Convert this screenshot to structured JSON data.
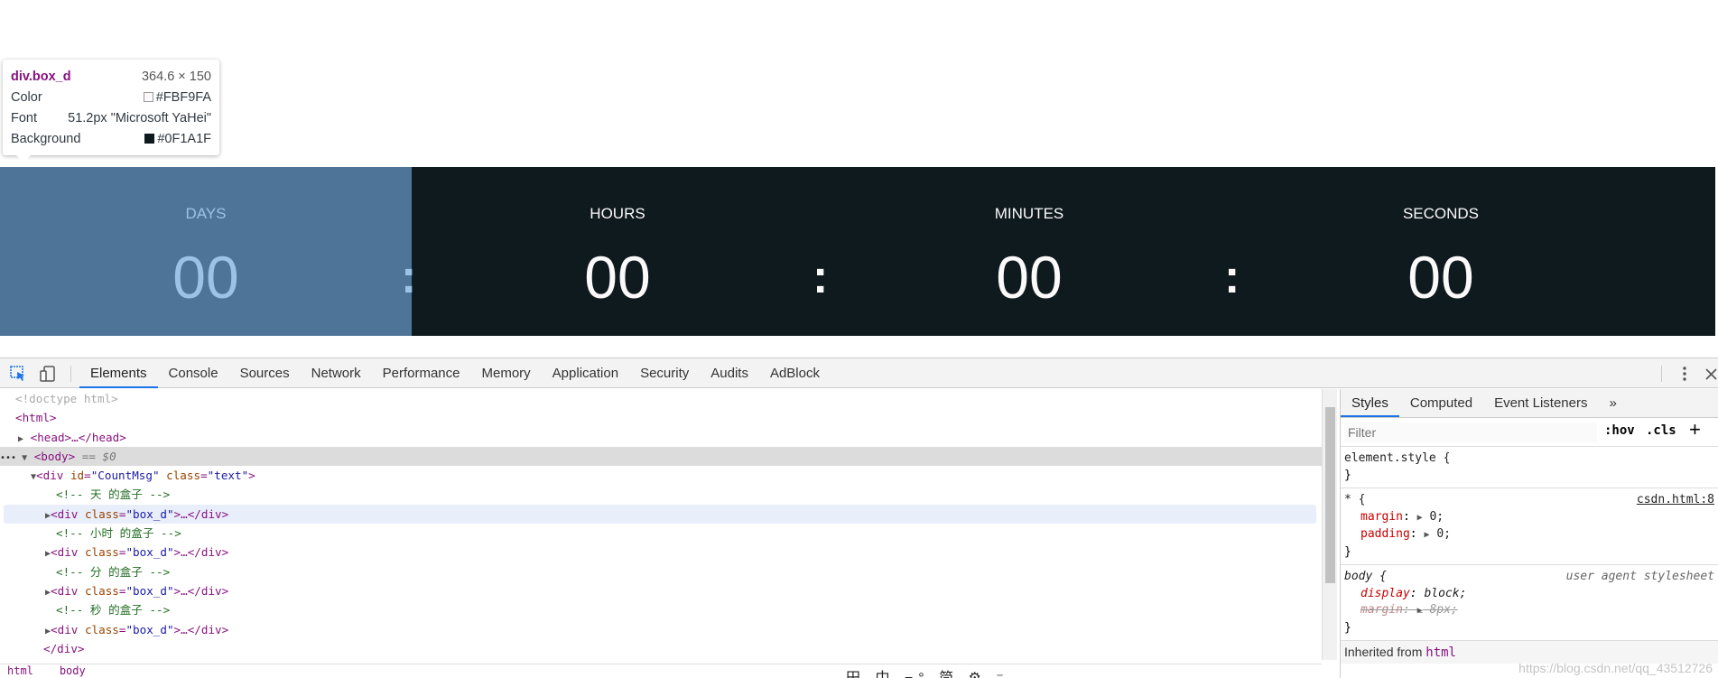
{
  "countdown": {
    "boxes": [
      {
        "label": "DAYS",
        "value": "00",
        "colon": ":"
      },
      {
        "label": "HOURS",
        "value": "00",
        "colon": ":"
      },
      {
        "label": "MINUTES",
        "value": "00",
        "colon": ":"
      },
      {
        "label": "SECONDS",
        "value": "00",
        "colon": ""
      }
    ],
    "bg_color": "#0F1A1F",
    "highlight_color": "#4e7598"
  },
  "tooltip": {
    "tag": "div.box_d",
    "dims": "364.6 × 150",
    "color_label": "Color",
    "color_value": "#FBF9FA",
    "font_label": "Font",
    "font_value": "51.2px \"Microsoft YaHei\"",
    "bg_label": "Background",
    "bg_value": "#0F1A1F"
  },
  "devtools": {
    "tabs": [
      "Elements",
      "Console",
      "Sources",
      "Network",
      "Performance",
      "Memory",
      "Application",
      "Security",
      "Audits",
      "AdBlock"
    ],
    "active_tab": "Elements",
    "dom": {
      "doctype": "<!doctype html>",
      "html_open": "<html>",
      "head": "<head>…</head>",
      "body": "<body>",
      "body_eq": " == $0",
      "div_open_tag": "<div ",
      "div_id_attr": "id",
      "div_id_val": "\"CountMsg\"",
      "div_class_attr": "class",
      "div_class_val": "\"text\"",
      "div_close_bracket": ">",
      "comment_day": "<!-- 天 的盒子 -->",
      "comment_hour": "<!-- 小时 的盒子 -->",
      "comment_min": "<!-- 分 的盒子 -->",
      "comment_sec": "<!-- 秒 的盒子 -->",
      "box_open": "<div ",
      "box_class_attr": "class",
      "box_class_val": "\"box_d\"",
      "box_rest": ">…</div>",
      "div_close": "</div>"
    },
    "breadcrumbs": [
      "html",
      "body"
    ],
    "ime_bar": "田 中 ⌐° 简 ⚙ ⁻",
    "styles": {
      "tabs": [
        "Styles",
        "Computed",
        "Event Listeners"
      ],
      "more": "»",
      "filter_placeholder": "Filter",
      "hov": ":hov",
      "cls": ".cls",
      "plus": "+",
      "element_style": "element.style {",
      "close_brace": "}",
      "universal_selector": "* {",
      "universal_source": "csdn.html:8",
      "margin_prop": "margin",
      "margin_val": "0;",
      "padding_prop": "padding",
      "padding_val": "0;",
      "body_selector": "body {",
      "ua_label": "user agent stylesheet",
      "display_prop": "display",
      "display_val": "block;",
      "body_margin_prop": "margin",
      "body_margin_val": "8px;",
      "inherited_label": "Inherited from",
      "inherited_tag": "html"
    },
    "watermark": "https://blog.csdn.net/qq_43512726"
  }
}
